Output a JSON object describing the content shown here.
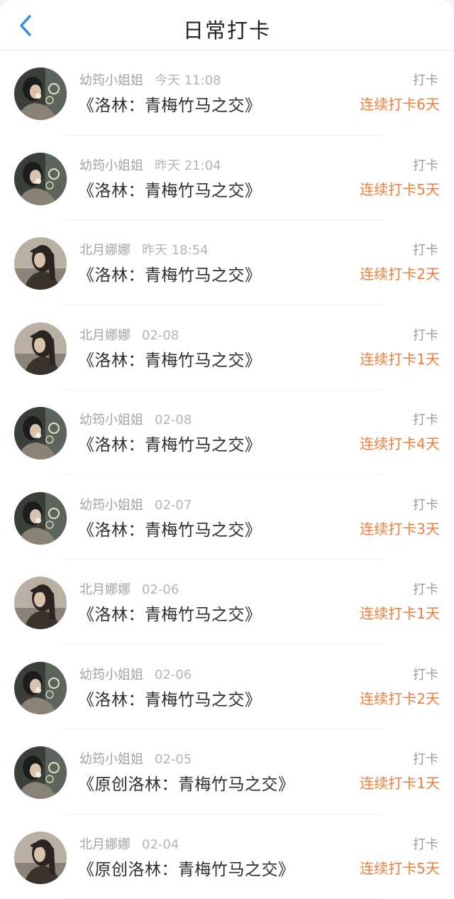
{
  "header": {
    "title": "日常打卡",
    "back_icon": "chevron-left-icon",
    "accent_color": "#2f8cf0"
  },
  "colors": {
    "streak": "#ee7d3a",
    "meta": "#a3a3a3"
  },
  "entries": [
    {
      "user": "幼筠小姐姐",
      "time": "今天 11:08",
      "book": "《洛林：青梅竹马之交》",
      "type": "打卡",
      "streak": "连续打卡6天",
      "avatar": "avatar-a"
    },
    {
      "user": "幼筠小姐姐",
      "time": "昨天 21:04",
      "book": "《洛林：青梅竹马之交》",
      "type": "打卡",
      "streak": "连续打卡5天",
      "avatar": "avatar-a"
    },
    {
      "user": "北月娜娜",
      "time": "昨天 18:54",
      "book": "《洛林：青梅竹马之交》",
      "type": "打卡",
      "streak": "连续打卡2天",
      "avatar": "avatar-b"
    },
    {
      "user": "北月娜娜",
      "time": "02-08",
      "book": "《洛林：青梅竹马之交》",
      "type": "打卡",
      "streak": "连续打卡1天",
      "avatar": "avatar-b"
    },
    {
      "user": "幼筠小姐姐",
      "time": "02-08",
      "book": "《洛林：青梅竹马之交》",
      "type": "打卡",
      "streak": "连续打卡4天",
      "avatar": "avatar-a"
    },
    {
      "user": "幼筠小姐姐",
      "time": "02-07",
      "book": "《洛林：青梅竹马之交》",
      "type": "打卡",
      "streak": "连续打卡3天",
      "avatar": "avatar-a"
    },
    {
      "user": "北月娜娜",
      "time": "02-06",
      "book": "《洛林：青梅竹马之交》",
      "type": "打卡",
      "streak": "连续打卡1天",
      "avatar": "avatar-b"
    },
    {
      "user": "幼筠小姐姐",
      "time": "02-06",
      "book": "《洛林：青梅竹马之交》",
      "type": "打卡",
      "streak": "连续打卡2天",
      "avatar": "avatar-a"
    },
    {
      "user": "幼筠小姐姐",
      "time": "02-05",
      "book": "《原创洛林：青梅竹马之交》",
      "type": "打卡",
      "streak": "连续打卡1天",
      "avatar": "avatar-a"
    },
    {
      "user": "北月娜娜",
      "time": "02-04",
      "book": "《原创洛林：青梅竹马之交》",
      "type": "打卡",
      "streak": "连续打卡5天",
      "avatar": "avatar-b"
    }
  ]
}
